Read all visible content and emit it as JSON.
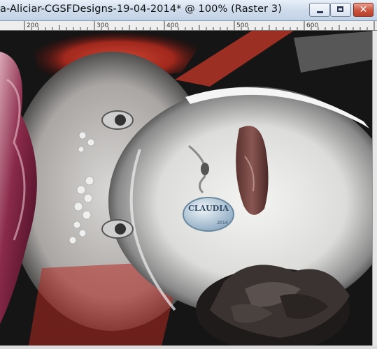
{
  "window": {
    "title": "a-Aliciar-CGSFDesigns-19-04-2014* @ 100% (Raster 3)",
    "minimize_label": "minimize",
    "maximize_label": "maximize",
    "close_label": "close"
  },
  "ruler": {
    "labels": [
      "200",
      "300",
      "400",
      "500",
      "600"
    ]
  },
  "canvas": {
    "watermark_text": "CLAUDIA",
    "watermark_subtext": "2014"
  },
  "colors": {
    "titlebar": "#cfdceb",
    "close_button": "#c9533c",
    "canvas_background": "#111111",
    "accent_red": "#d23a2a"
  }
}
